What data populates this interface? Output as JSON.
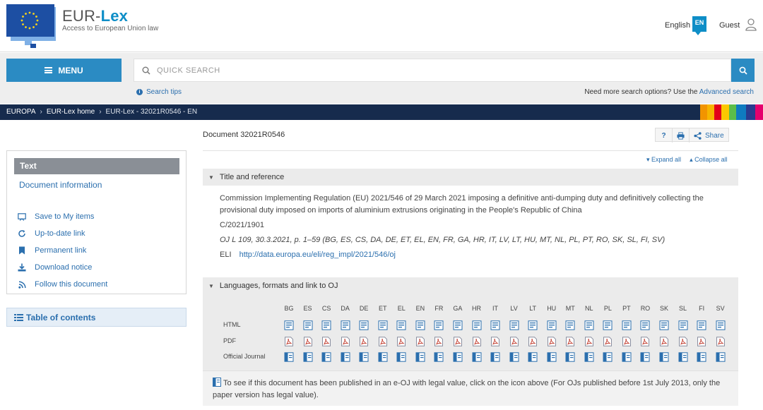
{
  "header": {
    "brand_prefix": "EUR-",
    "brand_suffix": "Lex",
    "subtitle": "Access to European Union law",
    "language_label": "English",
    "language_code": "EN",
    "guest_label": "Guest"
  },
  "search": {
    "menu_label": "MENU",
    "placeholder": "QUICK SEARCH",
    "tips_label": "Search tips",
    "more_options_text": "Need more search options? Use the",
    "advanced_link": "Advanced search"
  },
  "breadcrumb": {
    "items": [
      "EUROPA",
      "EUR-Lex home",
      "EUR-Lex - 32021R0546 - EN"
    ],
    "stripe_colors": [
      "#f29400",
      "#f7b500",
      "#e2001a",
      "#fbc800",
      "#5bbd4a",
      "#0f7bc0",
      "#2a3b8f",
      "#e5006d"
    ]
  },
  "sidebar": {
    "active_tab": "Text",
    "document_information": "Document information",
    "actions": [
      {
        "label": "Save to My items",
        "icon": "save-icon"
      },
      {
        "label": "Up-to-date link",
        "icon": "refresh-icon"
      },
      {
        "label": "Permanent link",
        "icon": "bookmark-icon"
      },
      {
        "label": "Download notice",
        "icon": "download-icon"
      },
      {
        "label": "Follow this document",
        "icon": "rss-icon"
      }
    ],
    "toc_label": "Table of contents"
  },
  "document": {
    "title": "Document 32021R0546",
    "tools": {
      "help": "?",
      "print_icon": "print-icon",
      "share": "Share"
    },
    "expand_all": "Expand all",
    "collapse_all": "Collapse all",
    "section_title_reference": "Title and reference",
    "full_title": "Commission Implementing Regulation (EU) 2021/546 of 29 March 2021 imposing a definitive anti-dumping duty and definitively collecting the provisional duty imposed on imports of aluminium extrusions originating in the People's Republic of China",
    "celex_ref": "C/2021/1901",
    "oj_ref": "OJ L 109, 30.3.2021, p. 1–59 (BG, ES, CS, DA, DE, ET, EL, EN, FR, GA, HR, IT, LV, LT, HU, MT, NL, PL, PT, RO, SK, SL, FI, SV)",
    "eli_label": "ELI",
    "eli_url": "http://data.europa.eu/eli/reg_impl/2021/546/oj",
    "section_languages": "Languages, formats and link to OJ",
    "languages": [
      "BG",
      "ES",
      "CS",
      "DA",
      "DE",
      "ET",
      "EL",
      "EN",
      "FR",
      "GA",
      "HR",
      "IT",
      "LV",
      "LT",
      "HU",
      "MT",
      "NL",
      "PL",
      "PT",
      "RO",
      "SK",
      "SL",
      "FI",
      "SV"
    ],
    "format_rows": [
      "HTML",
      "PDF",
      "Official Journal"
    ],
    "oj_note": "To see if this document has been published in an e-OJ with legal value, click on the icon above (For OJs published before 1st July 2013, only the paper version has legal value)."
  }
}
